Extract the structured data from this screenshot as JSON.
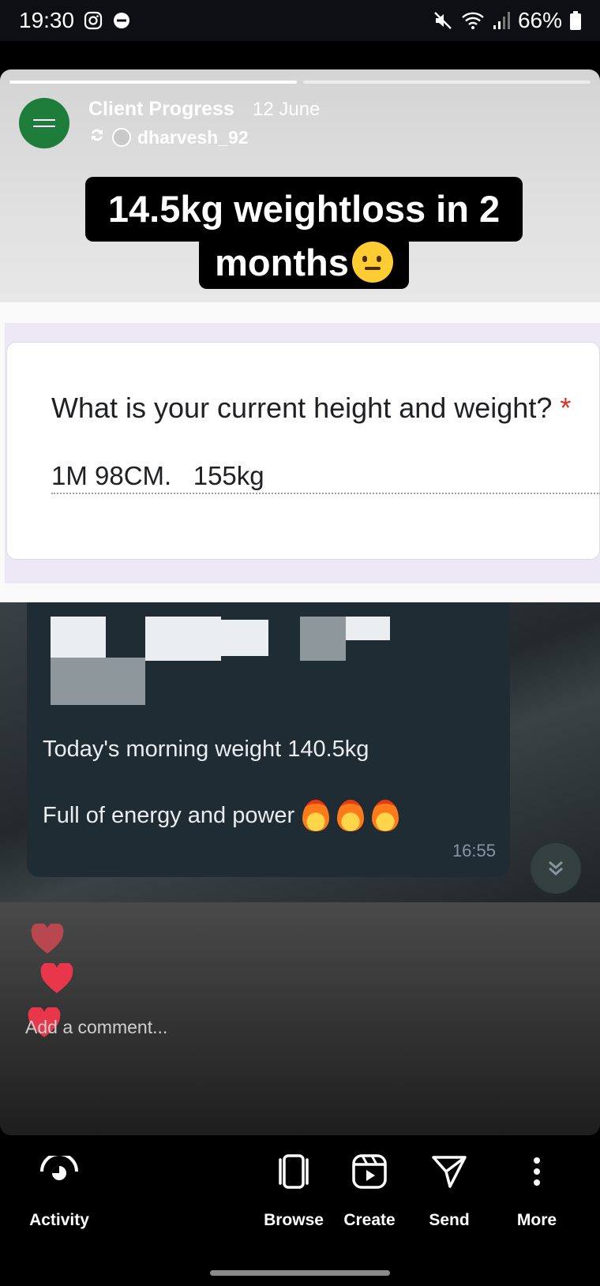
{
  "status_bar": {
    "time": "19:30",
    "battery": "66%"
  },
  "story": {
    "account_name": "Client Progress",
    "date": "12 June",
    "reshared_from": "dharvesh_92",
    "progress": [
      1.0,
      0.0
    ],
    "caption_line1": "14.5kg weightloss in 2",
    "caption_line2": "months"
  },
  "form": {
    "question": "What is your current height and weight?",
    "required_mark": "*",
    "answer": "1M 98CM.   155kg"
  },
  "chat": {
    "line1": "Today's morning weight 140.5kg",
    "line2": "Full of energy and power",
    "time": "16:55"
  },
  "comment": {
    "placeholder": "Add a comment..."
  },
  "nav": {
    "activity": "Activity",
    "browse": "Browse",
    "create": "Create",
    "send": "Send",
    "more": "More"
  },
  "colors": {
    "avatar_green": "#1f7d3c",
    "heart_red": "#e8374a",
    "chat_bubble": "#1f2c33"
  }
}
